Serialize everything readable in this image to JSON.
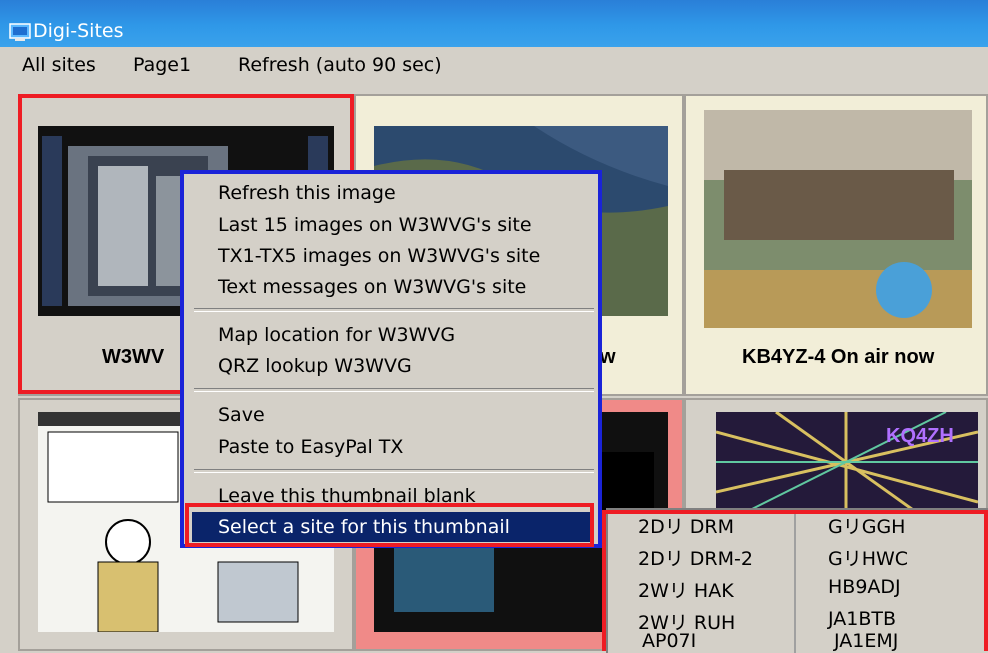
{
  "window": {
    "title": "Digi-Sites"
  },
  "menu": {
    "items": [
      "All sites",
      "Page1",
      "Refresh (auto 90 sec)"
    ]
  },
  "thumbnails": {
    "t1_label": "W3WV",
    "t2_label": "w",
    "t3_label": "KB4YZ-4 On air now",
    "t6_logo": "KQ4ZH"
  },
  "context_menu": {
    "group1": [
      "Refresh this image",
      "Last 15 images on W3WVG's site",
      "TX1-TX5 images on W3WVG's site",
      "Text messages on W3WVG's site"
    ],
    "group2": [
      "Map location for W3WVG",
      "QRZ lookup W3WVG"
    ],
    "group3": [
      "Save",
      "Paste to EasyPal TX"
    ],
    "group4": [
      "Leave this thumbnail blank"
    ],
    "selected": "Select a site for this thumbnail"
  },
  "site_list": {
    "col1": [
      "2Dリ DRM",
      "2Dリ DRM-2",
      "2Wリ HAK",
      "2Wリ RUH",
      "AP07I"
    ],
    "col2": [
      "GリGGH",
      "GリHWC",
      "HB9ADJ",
      "JA1BTB",
      "JA1EMJ"
    ]
  },
  "colors": {
    "titlebar": "#2f98e8",
    "highlight": "#0a246a",
    "annotation_red": "#ee1c24",
    "annotation_blue": "#1a23d8",
    "thumb_bg": "#f2eed8"
  }
}
